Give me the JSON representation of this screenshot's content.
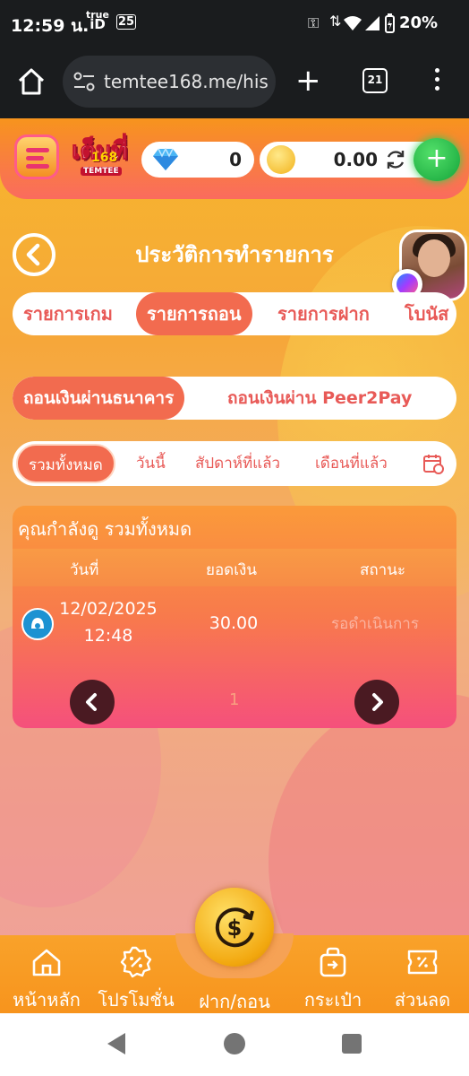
{
  "status_bar": {
    "time": "12:59 น.",
    "carrier_top": "true",
    "carrier_bottom": "iD",
    "battery": "20%"
  },
  "browser": {
    "url": "temtee168.me/his",
    "tab_count": "21"
  },
  "header": {
    "logo_main": "เต็มที่",
    "logo_num": "168",
    "logo_sub": "TEMTEE",
    "gem_balance": "0",
    "coin_balance": "0.00"
  },
  "page_title": "ประวัติการทำรายการ",
  "main_tabs": [
    {
      "label": "รายการเกม",
      "active": false
    },
    {
      "label": "รายการถอน",
      "active": true
    },
    {
      "label": "รายการฝาก",
      "active": false
    },
    {
      "label": "โบนัส",
      "active": false
    }
  ],
  "method_tabs": [
    {
      "label": "ถอนเงินผ่านธนาคาร",
      "active": true
    },
    {
      "label": "ถอนเงินผ่าน Peer2Pay",
      "active": false
    }
  ],
  "period_tabs": [
    {
      "label": "รวมทั้งหมด",
      "active": true
    },
    {
      "label": "วันนี้",
      "active": false
    },
    {
      "label": "สัปดาห์ที่แล้ว",
      "active": false
    },
    {
      "label": "เดือนที่แล้ว",
      "active": false
    }
  ],
  "table": {
    "viewing_label": "คุณกำลังดู  รวมทั้งหมด",
    "columns": [
      "วันที่",
      "ยอดเงิน",
      "สถานะ"
    ],
    "rows": [
      {
        "date": "12/02/2025",
        "time": "12:48",
        "amount": "30.00",
        "status": "รอดำเนินการ"
      }
    ],
    "page": "1"
  },
  "bottom_nav": [
    {
      "label": "หน้าหลัก",
      "icon": "home-icon"
    },
    {
      "label": "โปรโมชั่น",
      "icon": "promo-badge-icon"
    },
    {
      "label": "ฝาก/ถอน",
      "icon": "deposit-withdraw-icon"
    },
    {
      "label": "กระเป๋า",
      "icon": "bag-icon"
    },
    {
      "label": "ส่วนลด",
      "icon": "ticket-icon"
    }
  ],
  "colors": {
    "accent": "#f26b4f",
    "tab_text": "#e85a57",
    "add_button": "#22b544"
  }
}
